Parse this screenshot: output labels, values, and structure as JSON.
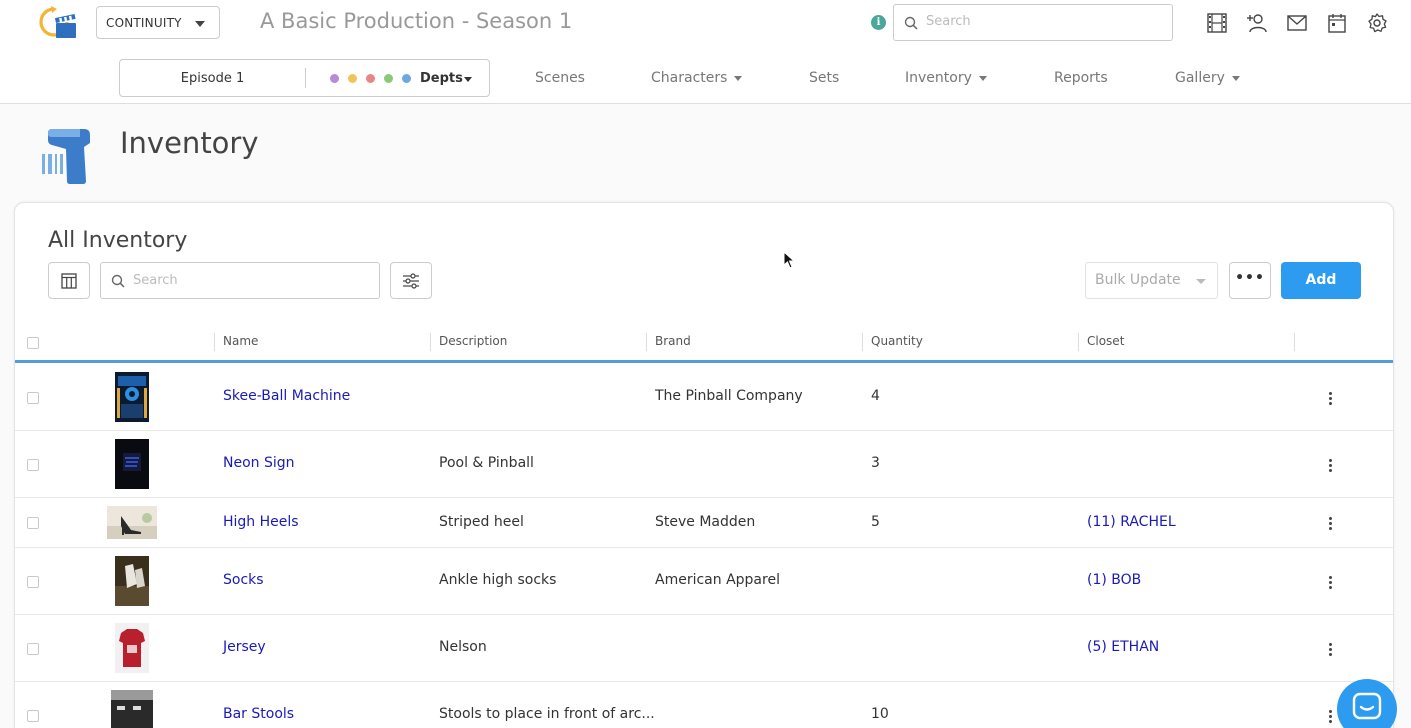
{
  "header": {
    "app_select": "CONTINUITY",
    "production_title": "A Basic Production - Season 1",
    "search_placeholder": "Search"
  },
  "subnav": {
    "episode": "Episode 1",
    "depts_label": "Depts",
    "dept_colors": [
      "#b58ad6",
      "#f2c35a",
      "#e98585",
      "#8bc878",
      "#6fa6e4"
    ],
    "items": [
      {
        "label": "Scenes",
        "has_caret": false
      },
      {
        "label": "Characters",
        "has_caret": true
      },
      {
        "label": "Sets",
        "has_caret": false
      },
      {
        "label": "Inventory",
        "has_caret": true
      },
      {
        "label": "Reports",
        "has_caret": false
      },
      {
        "label": "Gallery",
        "has_caret": true
      }
    ]
  },
  "page": {
    "title": "Inventory",
    "card_title": "All Inventory",
    "search_placeholder": "Search",
    "bulk_update_label": "Bulk Update",
    "more_label": "•••",
    "add_label": "Add"
  },
  "table": {
    "columns": [
      "Name",
      "Description",
      "Brand",
      "Quantity",
      "Closet"
    ],
    "rows": [
      {
        "name": "Skee-Ball Machine",
        "description": "",
        "brand": "The Pinball Company",
        "quantity": "4",
        "closet": "",
        "thumb": "skee-ball-thumbnail"
      },
      {
        "name": "Neon Sign",
        "description": "Pool & Pinball",
        "brand": "",
        "quantity": "3",
        "closet": "",
        "thumb": "neon-sign-thumbnail"
      },
      {
        "name": "High Heels",
        "description": "Striped heel",
        "brand": "Steve Madden",
        "quantity": "5",
        "closet": "(11) RACHEL",
        "thumb": "high-heels-thumbnail"
      },
      {
        "name": "Socks",
        "description": "Ankle high socks",
        "brand": "American Apparel",
        "quantity": "",
        "closet": "(1) BOB",
        "thumb": "socks-thumbnail"
      },
      {
        "name": "Jersey",
        "description": "Nelson",
        "brand": "",
        "quantity": "",
        "closet": "(5) ETHAN",
        "thumb": "jersey-thumbnail"
      },
      {
        "name": "Bar Stools",
        "description": "Stools to place in front of arc...",
        "brand": "",
        "quantity": "10",
        "closet": "",
        "thumb": "bar-stools-thumbnail"
      }
    ]
  },
  "colors": {
    "accent": "#2d9cf0",
    "link": "#1a1ab8",
    "header_underline": "#5a9ad6",
    "info": "#4aa89a"
  },
  "icons": {
    "top_right": [
      "film-icon",
      "add-user-icon",
      "mail-icon",
      "calendar-icon",
      "gear-icon"
    ]
  }
}
